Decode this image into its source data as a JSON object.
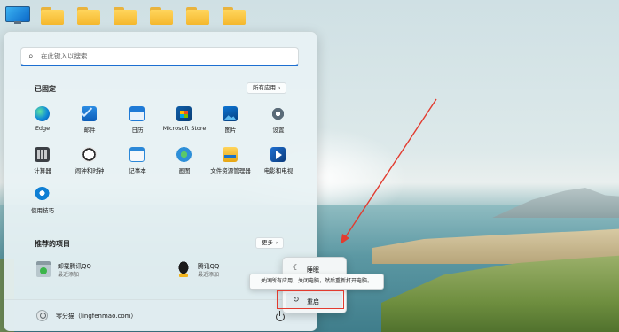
{
  "search": {
    "placeholder": "在此键入以搜索"
  },
  "pinned": {
    "title": "已固定",
    "all_apps_label": "所有应用",
    "apps": [
      {
        "label": "Edge",
        "icon": "edge-icon"
      },
      {
        "label": "邮件",
        "icon": "mail-icon"
      },
      {
        "label": "日历",
        "icon": "calendar-icon"
      },
      {
        "label": "Microsoft Store",
        "icon": "store-icon"
      },
      {
        "label": "图片",
        "icon": "photos-icon"
      },
      {
        "label": "设置",
        "icon": "settings-icon"
      },
      {
        "label": "计算器",
        "icon": "calculator-icon"
      },
      {
        "label": "闹钟和时钟",
        "icon": "clock-icon"
      },
      {
        "label": "记事本",
        "icon": "notepad-icon"
      },
      {
        "label": "画图",
        "icon": "paint-icon"
      },
      {
        "label": "文件资源管理器",
        "icon": "file-explorer-icon"
      },
      {
        "label": "电影和电视",
        "icon": "movies-tv-icon"
      },
      {
        "label": "使用技巧",
        "icon": "tips-icon"
      }
    ]
  },
  "recommended": {
    "title": "推荐的项目",
    "more_label": "更多",
    "items": [
      {
        "name": "卸载腾讯QQ",
        "sub": "最近添加",
        "icon": "uninstall-icon"
      },
      {
        "name": "腾讯QQ",
        "sub": "最近添加",
        "icon": "qq-icon"
      }
    ]
  },
  "user": {
    "name": "零分猫（lingfenmao.com）"
  },
  "power_menu": {
    "sleep_label": "睡眠",
    "restart_label": "重启",
    "tooltip": "关闭所有应用，关闭电脑，然后重新打开电脑。"
  },
  "colors": {
    "accent": "#1d6fd1",
    "highlight": "#e23b2f"
  }
}
